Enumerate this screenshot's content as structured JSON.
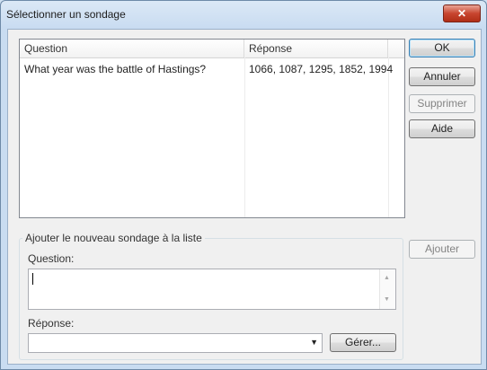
{
  "window": {
    "title": "Sélectionner un sondage",
    "close_glyph": "✕"
  },
  "list": {
    "columns": [
      "Question",
      "Réponse"
    ],
    "rows": [
      {
        "question": "What year was the battle of Hastings?",
        "answer": "1066, 1087, 1295, 1852, 1994"
      }
    ]
  },
  "buttons": {
    "ok": "OK",
    "cancel": "Annuler",
    "delete": "Supprimer",
    "help": "Aide",
    "add": "Ajouter",
    "manage": "Gérer..."
  },
  "add_group": {
    "title": "Ajouter le nouveau sondage à la liste",
    "question_label": "Question:",
    "question_value": "",
    "answer_label": "Réponse:",
    "answer_value": ""
  },
  "icons": {
    "scroll_up": "▲",
    "scroll_down": "▼",
    "dropdown": "▼"
  }
}
